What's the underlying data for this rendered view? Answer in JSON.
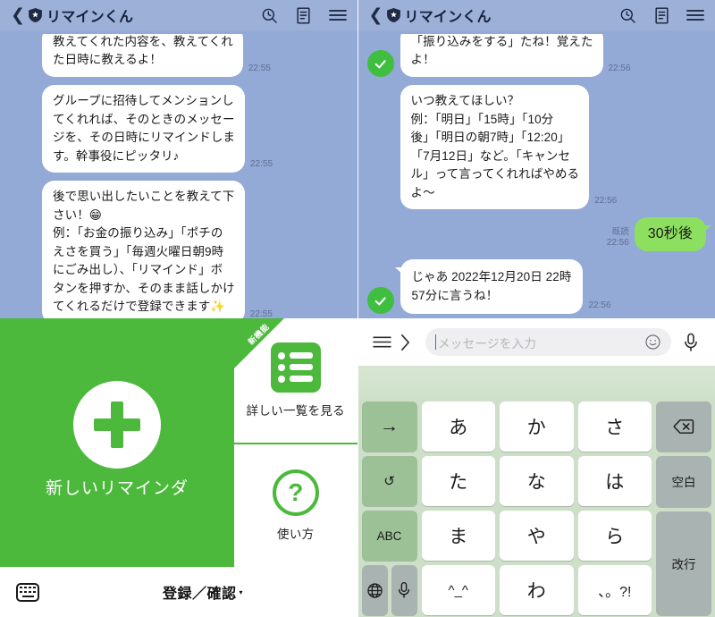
{
  "header": {
    "back_icon": "chevron-left-icon",
    "verified_badge": "shield-star-icon",
    "title": "リマインくん",
    "icons": [
      "search-history-icon",
      "notes-icon",
      "menu-icon"
    ]
  },
  "left_panel": {
    "messages": [
      {
        "from": "bot",
        "text": "教えてくれた内容を、教えてくれ\nた日時に教えるよ！",
        "time": "22:55",
        "clipped": true
      },
      {
        "from": "bot",
        "text": "グループに招待してメンションし\nてくれれば、そのときのメッセー\nジを、その日時にリマインドしま\nす。幹事役にピッタリ♪",
        "time": "22:55"
      },
      {
        "from": "bot",
        "text": "後で思い出したいことを教えて下\nさい！😁\n例：「お金の振り込み」「ポチの\nえさを買う」「毎週火曜日朝9時\nにごみ出し）、「リマインド」ボ\nタンを押すか、そのまま話しかけ\nてくれるだけで登録できます✨",
        "time": "22:55"
      }
    ],
    "rich_menu": {
      "primary": {
        "icon": "plus-icon",
        "label": "新しいリマインダ"
      },
      "cells": [
        {
          "icon": "list-icon",
          "label": "詳しい一覧を見る",
          "ribbon": "新機能"
        },
        {
          "icon": "question-mark-icon",
          "label": "使い方"
        }
      ]
    },
    "bottom_bar": {
      "keyboard_icon": "keyboard-icon",
      "action_label": "登録／確認",
      "caret": "▾"
    }
  },
  "right_panel": {
    "messages": [
      {
        "from": "bot",
        "text": "「振り込みをする」たね！覚えた\nよ！",
        "time": "22:56",
        "clipped": true
      },
      {
        "from": "bot",
        "text": "いつ教えてほしい？\n例：「明日」「15時」「10分\n後」「明日の朝7時」「12:20」\n「7月12日」など。「キャンセ\nル」って言ってくれればやめる\nよ〜",
        "time": "22:56"
      },
      {
        "from": "user",
        "text": "30秒後",
        "time": "22:56",
        "read": "既読"
      },
      {
        "from": "bot",
        "text": "じゃあ 2022年12月20日 22時\n57分に言うね！",
        "time": "22:56"
      }
    ],
    "input_bar": {
      "menu_icon": "menu-icon",
      "expand_icon": "chevron-right-icon",
      "placeholder": "メッセージを入力",
      "value": "",
      "emoji_icon": "smiley-icon",
      "mic_icon": "microphone-icon"
    },
    "keyboard": {
      "rows": [
        [
          {
            "label": "→",
            "type": "fn",
            "name": "cursor-right-key"
          },
          {
            "label": "あ",
            "type": "char",
            "name": "kana-a-key"
          },
          {
            "label": "か",
            "type": "char",
            "name": "kana-ka-key"
          },
          {
            "label": "さ",
            "type": "char",
            "name": "kana-sa-key"
          },
          {
            "label": "⌫",
            "type": "fn2",
            "name": "backspace-key"
          }
        ],
        [
          {
            "label": "↺",
            "type": "fn",
            "name": "undo-key"
          },
          {
            "label": "た",
            "type": "char",
            "name": "kana-ta-key"
          },
          {
            "label": "な",
            "type": "char",
            "name": "kana-na-key"
          },
          {
            "label": "は",
            "type": "char",
            "name": "kana-ha-key"
          },
          {
            "label": "空白",
            "type": "fn2",
            "name": "space-key"
          }
        ],
        [
          {
            "label": "ABC",
            "type": "fn",
            "name": "abc-mode-key"
          },
          {
            "label": "ま",
            "type": "char",
            "name": "kana-ma-key"
          },
          {
            "label": "や",
            "type": "char",
            "name": "kana-ya-key"
          },
          {
            "label": "ら",
            "type": "char",
            "name": "kana-ra-key"
          },
          {
            "label": "改行",
            "type": "fn2",
            "name": "enter-key"
          }
        ],
        [
          {
            "label": "globe-icon",
            "type": "fn2icon",
            "name": "globe-key"
          },
          {
            "label": "microphone-icon",
            "type": "fn2icon",
            "name": "voice-input-key"
          },
          {
            "label": "^_^",
            "type": "char",
            "name": "emoticon-key"
          },
          {
            "label": "わ",
            "type": "char",
            "name": "kana-wa-key"
          },
          {
            "label": "、。?!",
            "type": "char-small",
            "name": "punctuation-key"
          }
        ]
      ]
    }
  },
  "colors": {
    "chat_bg": "#93a9d6",
    "header_bg": "#9db0d8",
    "brand_green": "#4cb93c",
    "bubble_green": "#8de05f",
    "keyboard_bg": "#cddfc8"
  }
}
